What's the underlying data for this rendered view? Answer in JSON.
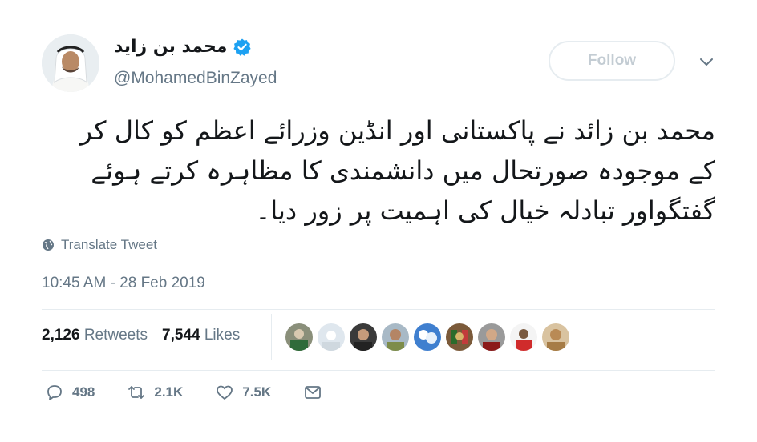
{
  "tweet": {
    "display_name": "محمد بن زايد",
    "handle": "@MohamedBinZayed",
    "follow_label": "Follow",
    "text": "محمد بن زائد نے پاکستانی اور انڈین وزرائے اعظم کو کال کر کے موجودہ صورتحال میں دانشمندی کا مظاہرہ کرتے ہوئے گفتگواور تبادلہ خیال کی اہمیت پر زور دیا۔",
    "translate_label": "Translate Tweet",
    "timestamp": "10:45 AM - 28 Feb 2019"
  },
  "stats": {
    "retweets_count": "2,126",
    "retweets_label": "Retweets",
    "likes_count": "7,544",
    "likes_label": "Likes"
  },
  "actions": {
    "reply_count": "498",
    "retweet_count": "2.1K",
    "like_count": "7.5K"
  },
  "colors": {
    "verified": "#1da1f2",
    "secondary_text": "#657786",
    "divider": "#e6ecf0"
  }
}
